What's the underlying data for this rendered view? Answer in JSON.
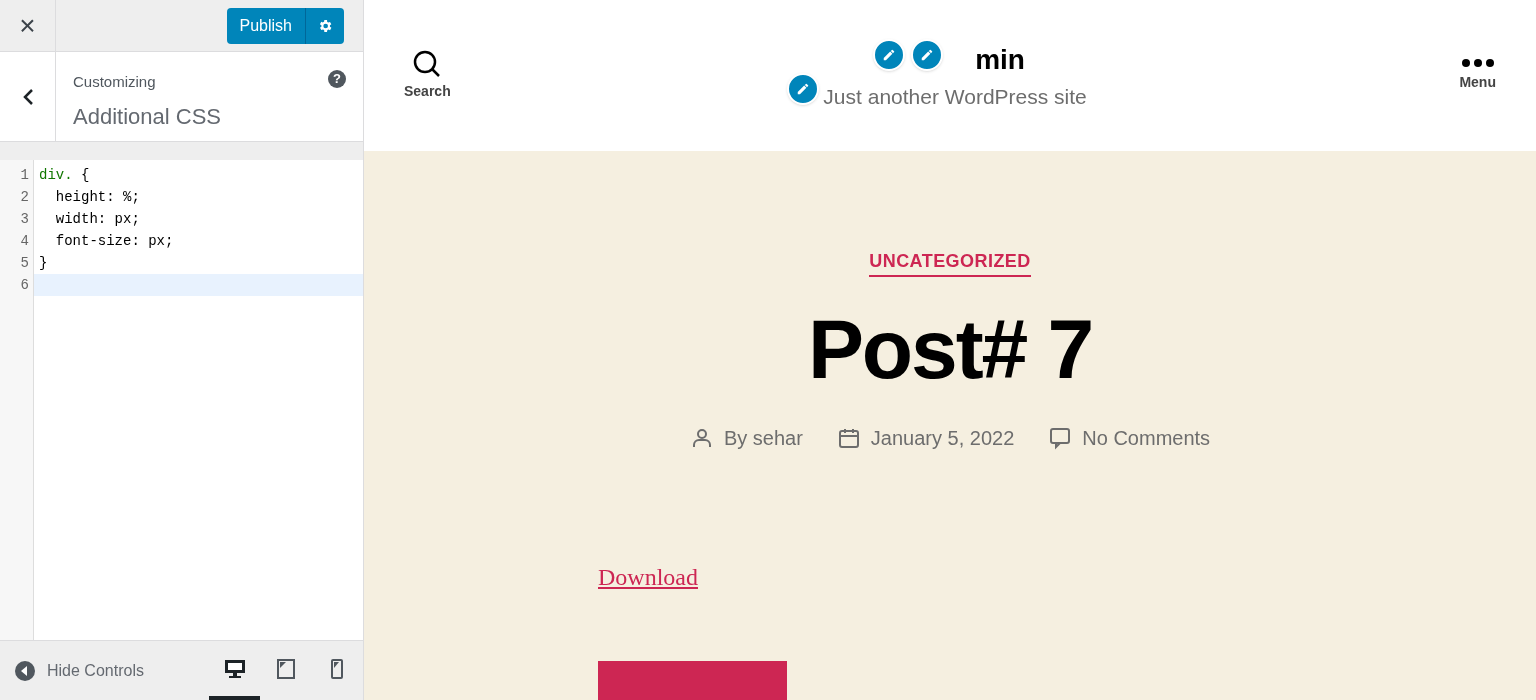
{
  "header": {
    "close": "×",
    "publish": "Publish"
  },
  "section": {
    "subtitle": "Customizing",
    "title": "Additional CSS",
    "help": "?"
  },
  "editor": {
    "lines": [
      {
        "number": "1",
        "active": false,
        "parts": [
          {
            "text": "div.",
            "kind": "selector"
          },
          {
            "text": " {",
            "kind": "plain"
          }
        ]
      },
      {
        "number": "2",
        "active": false,
        "parts": [
          {
            "text": "  height: %;",
            "kind": "plain"
          }
        ]
      },
      {
        "number": "3",
        "active": false,
        "parts": [
          {
            "text": "  width: px;",
            "kind": "plain"
          }
        ]
      },
      {
        "number": "4",
        "active": false,
        "parts": [
          {
            "text": "  font-size: px;",
            "kind": "plain"
          }
        ]
      },
      {
        "number": "5",
        "active": false,
        "parts": [
          {
            "text": "}",
            "kind": "plain"
          }
        ]
      },
      {
        "number": "6",
        "active": true
      }
    ]
  },
  "footer": {
    "hide_controls": "Hide Controls",
    "devices": [
      {
        "kind": "desktop",
        "selected": true
      },
      {
        "kind": "tablet",
        "selected": false
      },
      {
        "kind": "mobile",
        "selected": false
      }
    ]
  },
  "preview": {
    "search": "Search",
    "menu": "Menu",
    "site_title": "min",
    "tagline": "Just another WordPress site",
    "category": "UNCATEGORIZED",
    "post_title": "Post# 7",
    "meta": [
      {
        "kind": "author",
        "text": "By sehar"
      },
      {
        "kind": "date",
        "text": "January 5, 2022"
      },
      {
        "kind": "comments",
        "text": "No Comments"
      }
    ],
    "link": "Download"
  }
}
